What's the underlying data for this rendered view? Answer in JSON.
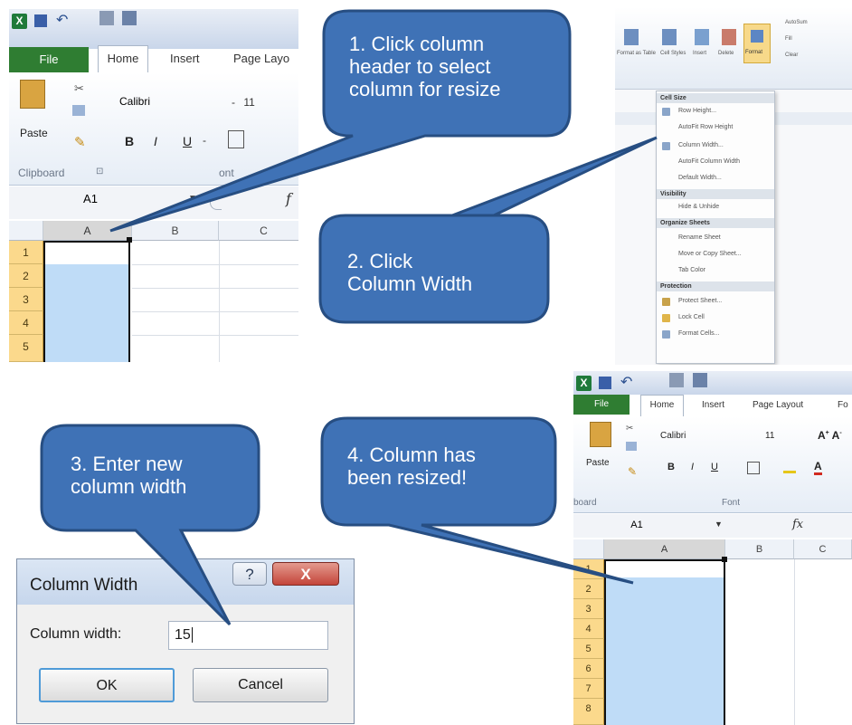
{
  "colors": {
    "callout_fill": "#3f72b6",
    "callout_stroke": "#274e82",
    "file_tab": "#2f7d32",
    "row_header": "#fbd98c",
    "selection": "#bfdcf7"
  },
  "panel1": {
    "tabs": {
      "file": "File",
      "home": "Home",
      "insert": "Insert",
      "page_layout": "Page Layo"
    },
    "paste_label": "Paste",
    "font_name": "Calibri",
    "font_size": "11",
    "bold": "B",
    "italic": "I",
    "underline": "U",
    "group_clipboard": "Clipboard",
    "group_font": "ont",
    "name_box": "A1",
    "fx": "f",
    "columns": [
      "A",
      "B",
      "C"
    ],
    "rows": [
      "1",
      "2",
      "3",
      "4",
      "5"
    ]
  },
  "panel2": {
    "menu": {
      "sections": [
        "Cell Size",
        "Visibility",
        "Organize Sheets",
        "Protection"
      ],
      "items": [
        "Row Height...",
        "AutoFit Row Height",
        "Column Width...",
        "AutoFit Column Width",
        "Default Width...",
        "Hide & Unhide",
        "Rename Sheet",
        "Move or Copy Sheet...",
        "Tab Color",
        "Protect Sheet...",
        "Lock Cell",
        "Format Cells..."
      ],
      "ribbon_buttons": [
        "Format as Table",
        "Cell Styles",
        "Insert",
        "Delete",
        "Format"
      ],
      "ribbon_right": [
        "AutoSum",
        "Fill",
        "Clear"
      ]
    }
  },
  "panel3": {
    "title": "Column Width",
    "help": "?",
    "close": "X",
    "field_label": "Column width:",
    "field_value": "15",
    "ok": "OK",
    "cancel": "Cancel"
  },
  "panel4": {
    "tabs": {
      "file": "File",
      "home": "Home",
      "insert": "Insert",
      "page_layout": "Page Layout",
      "fo": "Fo"
    },
    "paste_label": "Paste",
    "font_name": "Calibri",
    "font_size": "11",
    "bold": "B",
    "italic": "I",
    "underline": "U",
    "group_clipboard": "board",
    "group_font": "Font",
    "name_box": "A1",
    "fx": "fx",
    "columns": [
      "A",
      "B",
      "C"
    ],
    "rows": [
      "1",
      "2",
      "3",
      "4",
      "5",
      "6",
      "7",
      "8"
    ]
  },
  "callouts": {
    "c1": [
      "1. Click column",
      "header to select",
      "column for resize"
    ],
    "c2": [
      "2. Click",
      "Column Width"
    ],
    "c3": [
      "3. Enter new",
      "column width"
    ],
    "c4": [
      "4. Column has",
      "been resized!"
    ]
  }
}
